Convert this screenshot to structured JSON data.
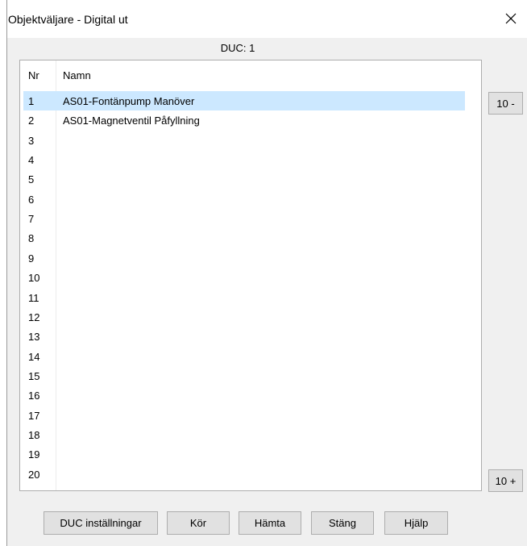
{
  "window": {
    "title": "Objektväljare - Digital ut"
  },
  "duc_label": "DUC: 1",
  "table": {
    "columns": [
      "Nr",
      "Namn"
    ],
    "rows": [
      {
        "nr": "1",
        "name": "AS01-Fontänpump Manöver",
        "selected": true
      },
      {
        "nr": "2",
        "name": "AS01-Magnetventil Påfyllning"
      },
      {
        "nr": "3",
        "name": ""
      },
      {
        "nr": "4",
        "name": ""
      },
      {
        "nr": "5",
        "name": ""
      },
      {
        "nr": "6",
        "name": ""
      },
      {
        "nr": "7",
        "name": ""
      },
      {
        "nr": "8",
        "name": ""
      },
      {
        "nr": "9",
        "name": ""
      },
      {
        "nr": "10",
        "name": ""
      },
      {
        "nr": "11",
        "name": ""
      },
      {
        "nr": "12",
        "name": ""
      },
      {
        "nr": "13",
        "name": ""
      },
      {
        "nr": "14",
        "name": ""
      },
      {
        "nr": "15",
        "name": ""
      },
      {
        "nr": "16",
        "name": ""
      },
      {
        "nr": "17",
        "name": ""
      },
      {
        "nr": "18",
        "name": ""
      },
      {
        "nr": "19",
        "name": ""
      },
      {
        "nr": "20",
        "name": ""
      }
    ]
  },
  "side_buttons": {
    "prev_label": "10 -",
    "next_label": "10 +"
  },
  "footer_buttons": [
    {
      "label": "DUC inställningar"
    },
    {
      "label": "Kör"
    },
    {
      "label": "Hämta"
    },
    {
      "label": "Stäng"
    },
    {
      "label": "Hjälp"
    }
  ],
  "colors": {
    "selection": "#cce8ff",
    "dialog_background": "#f0f0f0",
    "button_face": "#e1e1e1"
  },
  "icons": {
    "close": "close-icon"
  }
}
